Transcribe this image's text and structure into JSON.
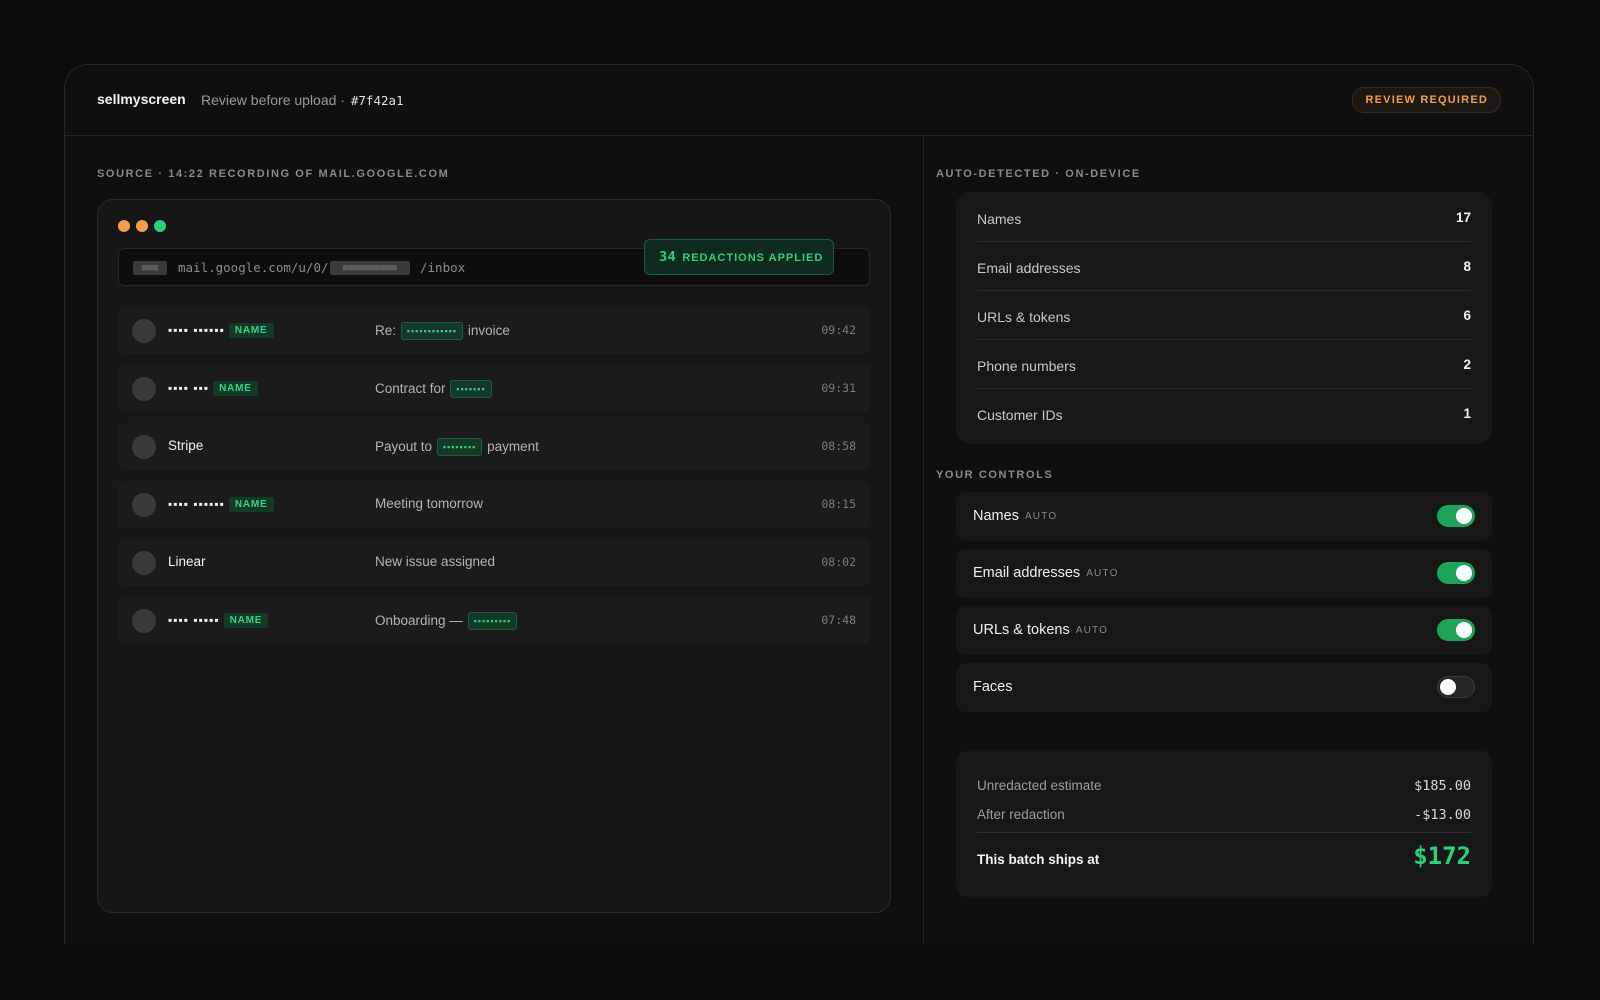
{
  "header": {
    "brand": "sellmyscreen",
    "subtitle": "Review before upload ·",
    "hash": "#7f42a1",
    "status_badge": "REVIEW REQUIRED"
  },
  "source": {
    "label": "SOURCE · 14:22 RECORDING OF MAIL.GOOGLE.COM",
    "address": {
      "block1": "■■■",
      "segment1": "mail.google.com/u/0/",
      "block2": "■■■■■■■■■■",
      "segment2": "/inbox"
    },
    "redactions": {
      "count": "34",
      "label": "REDACTIONS APPLIED"
    },
    "emails": [
      {
        "sender": "▪▪▪▪ ▪▪▪▪▪▪",
        "tag": "NAME",
        "subject_pre": "Re:",
        "pill": "▪▪▪▪▪▪▪▪▪▪▪▪",
        "subject_post": "invoice",
        "time": "09:42"
      },
      {
        "sender": "▪▪▪▪ ▪▪▪",
        "tag": "NAME",
        "subject_pre": "Contract for",
        "pill": "▪▪▪▪▪▪▪",
        "subject_post": "",
        "time": "09:31"
      },
      {
        "sender": "Stripe",
        "tag": "",
        "subject_pre": "Payout to",
        "pill": "▪▪▪▪▪▪▪▪",
        "subject_post": "payment",
        "time": "08:58"
      },
      {
        "sender": "▪▪▪▪ ▪▪▪▪▪▪",
        "tag": "NAME",
        "subject_pre": "Meeting tomorrow",
        "pill": "",
        "subject_post": "",
        "time": "08:15"
      },
      {
        "sender": "Linear",
        "tag": "",
        "subject_pre": "New issue assigned",
        "pill": "",
        "subject_post": "",
        "time": "08:02"
      },
      {
        "sender": "▪▪▪▪ ▪▪▪▪▪",
        "tag": "NAME",
        "subject_pre": "Onboarding —",
        "pill": "▪▪▪▪▪▪▪▪▪",
        "subject_post": "",
        "time": "07:48"
      }
    ]
  },
  "detected": {
    "label": "AUTO-DETECTED · ON-DEVICE",
    "items": [
      {
        "label": "Names",
        "count": "17"
      },
      {
        "label": "Email addresses",
        "count": "8"
      },
      {
        "label": "URLs & tokens",
        "count": "6"
      },
      {
        "label": "Phone numbers",
        "count": "2"
      },
      {
        "label": "Customer IDs",
        "count": "1"
      }
    ]
  },
  "controls": {
    "label": "YOUR CONTROLS",
    "items": [
      {
        "label": "Names",
        "auto": "AUTO",
        "on": true
      },
      {
        "label": "Email addresses",
        "auto": "AUTO",
        "on": true
      },
      {
        "label": "URLs & tokens",
        "auto": "AUTO",
        "on": true
      },
      {
        "label": "Faces",
        "auto": "",
        "on": false
      }
    ]
  },
  "pricing": {
    "unredacted_label": "Unredacted estimate",
    "unredacted_value": "$185.00",
    "after_label": "After redaction",
    "after_value": "-$13.00",
    "total_label": "This batch ships at",
    "total_value": "$172"
  },
  "colors": {
    "accent_green": "#2ad07a",
    "warning_orange": "#f0a04b",
    "dot_orange": "#f0a04b",
    "dot_green": "#2ad07a"
  }
}
